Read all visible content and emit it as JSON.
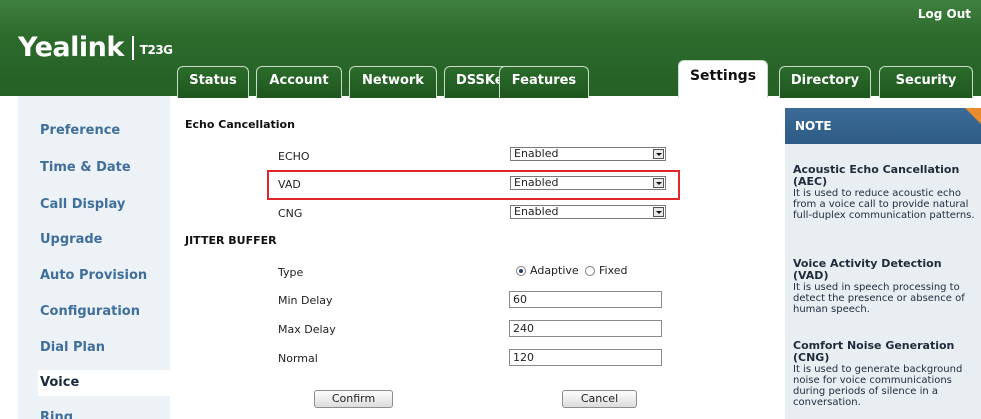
{
  "header": {
    "logo": "Yealink",
    "model": "T23G",
    "logout": "Log Out",
    "tabs": [
      {
        "label": "Status"
      },
      {
        "label": "Account"
      },
      {
        "label": "Network"
      },
      {
        "label": "DSSKey"
      },
      {
        "label": "Features"
      },
      {
        "label": "Settings",
        "active": true
      },
      {
        "label": "Directory"
      },
      {
        "label": "Security"
      }
    ]
  },
  "sidebar": {
    "items": [
      {
        "label": "Preference"
      },
      {
        "label": "Time & Date"
      },
      {
        "label": "Call Display"
      },
      {
        "label": "Upgrade"
      },
      {
        "label": "Auto Provision"
      },
      {
        "label": "Configuration"
      },
      {
        "label": "Dial Plan"
      },
      {
        "label": "Voice",
        "active": true
      },
      {
        "label": "Ring"
      }
    ]
  },
  "main": {
    "echo_section": "Echo Cancellation",
    "echo": {
      "label": "ECHO",
      "value": "Enabled"
    },
    "vad": {
      "label": "VAD",
      "value": "Enabled"
    },
    "cng": {
      "label": "CNG",
      "value": "Enabled"
    },
    "jitter_section": "JITTER BUFFER",
    "type": {
      "label": "Type",
      "option_adaptive": "Adaptive",
      "option_fixed": "Fixed",
      "selected": "Adaptive"
    },
    "min_delay": {
      "label": "Min Delay",
      "value": "60"
    },
    "max_delay": {
      "label": "Max Delay",
      "value": "240"
    },
    "normal": {
      "label": "Normal",
      "value": "120"
    },
    "confirm": "Confirm",
    "cancel": "Cancel",
    "highlight_color": "#e3262a"
  },
  "note": {
    "title": "NOTE",
    "items": [
      {
        "title": "Acoustic Echo Cancellation (AEC)",
        "text": "It is used to reduce acoustic echo from a voice call to provide natural full-duplex communication patterns."
      },
      {
        "title": "Voice Activity Detection (VAD)",
        "text": "It is used in speech processing to detect the presence or absence of human speech."
      },
      {
        "title": "Comfort Noise Generation (CNG)",
        "text": "It is used to generate background noise for voice communications during periods of silence in a conversation."
      }
    ]
  },
  "colors": {
    "header_green": "#2c6a2c",
    "sidebar_text": "#3f6f9a",
    "note_header": "#2d5b86",
    "note_corner": "#e98c2e"
  }
}
